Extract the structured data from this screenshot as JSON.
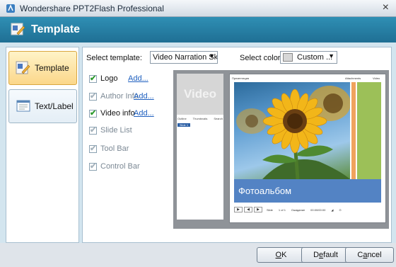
{
  "window": {
    "title": "Wondershare PPT2Flash Professional",
    "close_glyph": "×"
  },
  "banner": {
    "title": "Template"
  },
  "sidebar": {
    "items": [
      {
        "label": "Template",
        "icon": "template-icon",
        "active": true
      },
      {
        "label": "Text/Label",
        "icon": "text-label-icon",
        "active": false
      }
    ]
  },
  "template_select": {
    "label": "Select template:",
    "value": "Video Narration Skir"
  },
  "color_select": {
    "label": "Select color:",
    "value": "Custom ..."
  },
  "options": [
    {
      "label": "Logo",
      "checked": true,
      "enabled": true,
      "link": "Add..."
    },
    {
      "label": "Author Info",
      "checked": true,
      "enabled": false,
      "link": "Add..."
    },
    {
      "label": "Video info",
      "checked": true,
      "enabled": true,
      "link": "Add..."
    },
    {
      "label": "Slide List",
      "checked": true,
      "enabled": false
    },
    {
      "label": "Tool Bar",
      "checked": true,
      "enabled": false
    },
    {
      "label": "Control Bar",
      "checked": true,
      "enabled": false
    }
  ],
  "preview": {
    "video_placeholder": "Video",
    "tabs": [
      "Outline",
      "Thumbnails",
      "Search"
    ],
    "slide_item": "Slide 1",
    "top_title": "Презентация",
    "top_attachments": "Attachments",
    "top_video": "Video",
    "caption": "Фотоальбом",
    "controls": {
      "slide": "Slide",
      "of": "1 of 1",
      "status": "Ожидание",
      "time": "00:00/00:00"
    }
  },
  "footer": {
    "ok_u": "O",
    "ok_rest": "K",
    "default_pre": "D",
    "default_u": "e",
    "default_rest": "fault",
    "cancel_pre": "C",
    "cancel_u": "a",
    "cancel_rest": "ncel"
  },
  "colors": {
    "banner": "#2a84aa",
    "active_tab": "#fbd78a",
    "caption": "#5383c4",
    "accent_green": "#9cc058",
    "accent_orange": "#f0a35d"
  }
}
